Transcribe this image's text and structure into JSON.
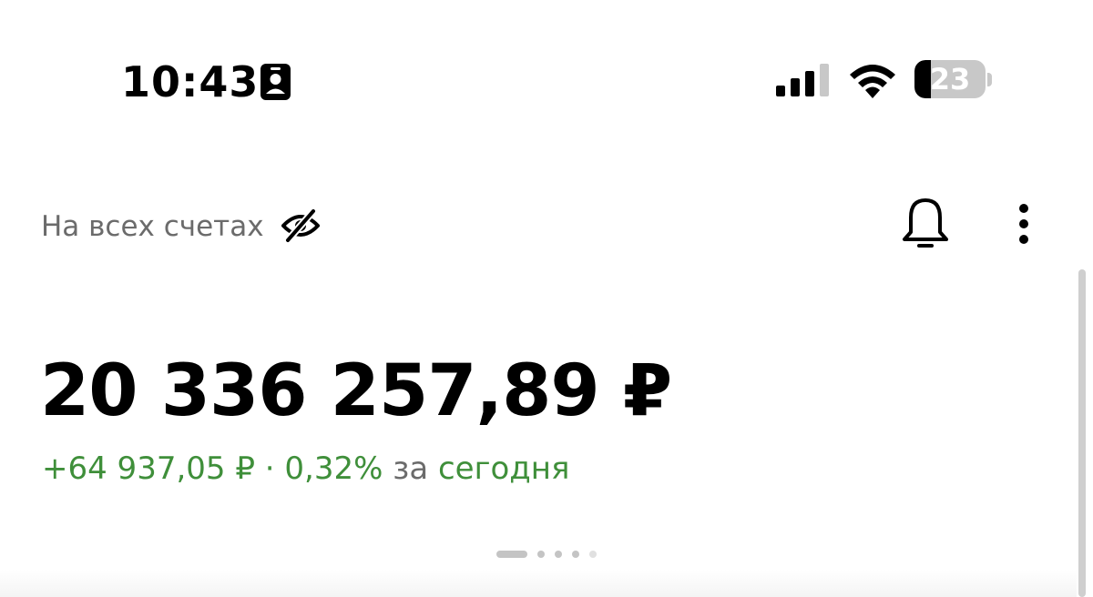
{
  "status_bar": {
    "time": "10:43",
    "battery_level": "23",
    "battery_fraction": 0.23,
    "icons": [
      "contact-badge-icon",
      "signal-icon",
      "wifi-icon",
      "battery-icon"
    ]
  },
  "header": {
    "accounts_label": "На всех счетах",
    "eye_icon": "eye-off-icon",
    "bell_icon": "bell-icon",
    "more_icon": "more-vertical-icon"
  },
  "balance": {
    "total": "20 336 257,89 ₽",
    "change_amount": "+64 937,05 ₽",
    "separator": "·",
    "change_percent": "0,32%",
    "period_prefix": "за",
    "period": "сегодня"
  },
  "pager": {
    "pages": 5,
    "active_index": 0
  },
  "colors": {
    "positive": "#3f8f3a",
    "secondary_text": "#6b6b6b",
    "primary_text": "#000000"
  }
}
